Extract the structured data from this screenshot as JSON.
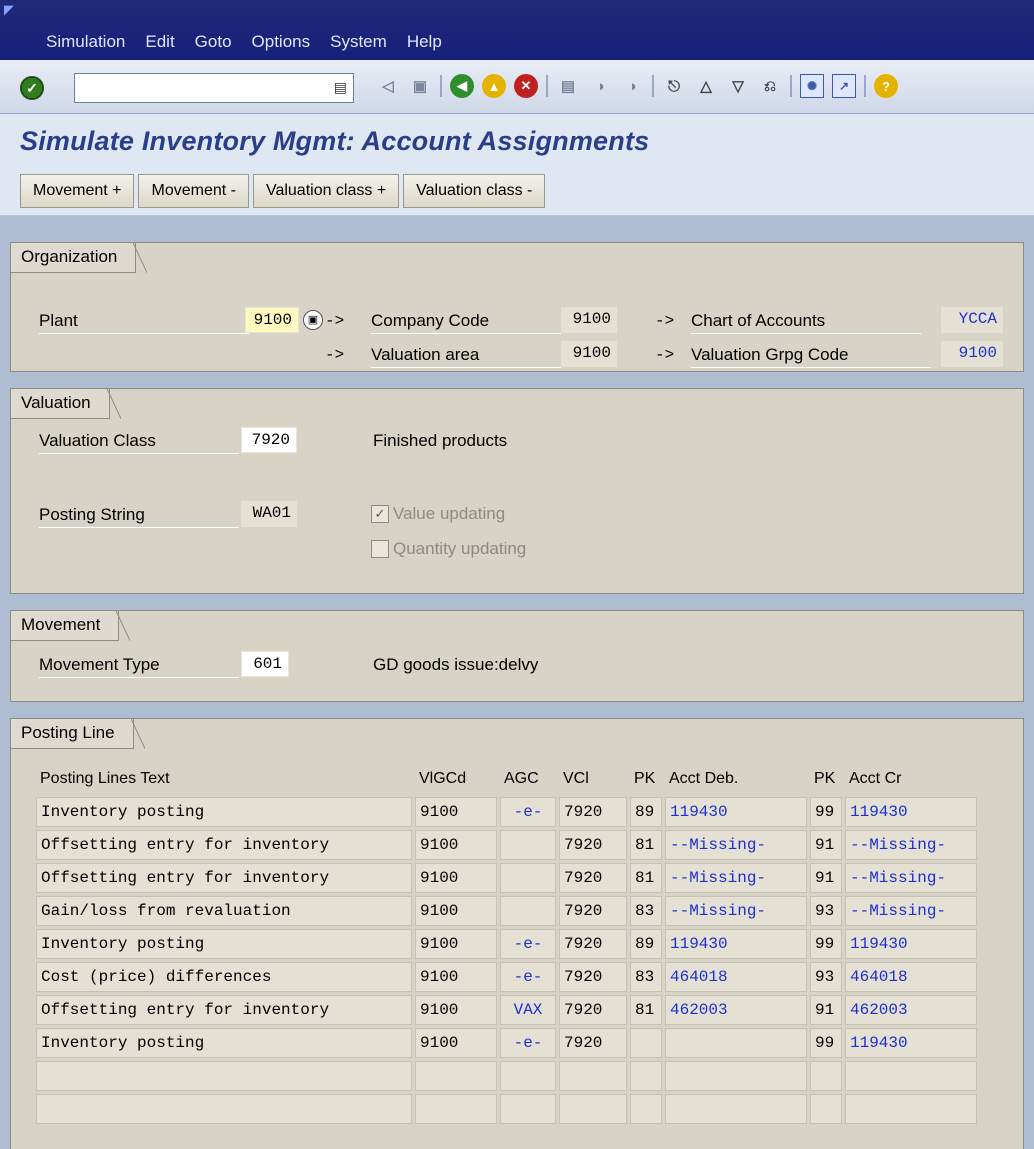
{
  "menu": [
    "Simulation",
    "Edit",
    "Goto",
    "Options",
    "System",
    "Help"
  ],
  "page_title": "Simulate Inventory Mgmt: Account Assignments",
  "app_buttons": [
    "Movement +",
    "Movement -",
    "Valuation class +",
    "Valuation class -"
  ],
  "organization": {
    "title": "Organization",
    "plant_label": "Plant",
    "plant_value": "9100",
    "company_code_label": "Company Code",
    "company_code_value": "9100",
    "chart_label": "Chart of Accounts",
    "chart_value": "YCCA",
    "valuation_area_label": "Valuation area",
    "valuation_area_value": "9100",
    "valuation_grpg_label": "Valuation Grpg Code",
    "valuation_grpg_value": "9100",
    "arrow": "->"
  },
  "valuation": {
    "title": "Valuation",
    "class_label": "Valuation Class",
    "class_value": "7920",
    "class_text": "Finished products",
    "posting_string_label": "Posting String",
    "posting_string_value": "WA01",
    "value_updating": "Value updating",
    "value_updating_checked": true,
    "quantity_updating": "Quantity updating",
    "quantity_updating_checked": false
  },
  "movement": {
    "title": "Movement",
    "type_label": "Movement Type",
    "type_value": "601",
    "type_text": "GD goods issue:delvy"
  },
  "posting_line": {
    "title": "Posting Line",
    "headers": [
      "Posting Lines Text",
      "VlGCd",
      "AGC",
      "VCl",
      "PK",
      "Acct Deb.",
      "PK",
      "Acct Cr"
    ],
    "rows": [
      [
        "Inventory posting",
        "9100",
        "-e-",
        "7920",
        "89",
        "119430",
        "99",
        "119430"
      ],
      [
        "Offsetting entry for inventory",
        "9100",
        "",
        "7920",
        "81",
        "--Missing-",
        "91",
        "--Missing-"
      ],
      [
        "Offsetting entry for inventory",
        "9100",
        "",
        "7920",
        "81",
        "--Missing-",
        "91",
        "--Missing-"
      ],
      [
        "Gain/loss from revaluation",
        "9100",
        "",
        "7920",
        "83",
        "--Missing-",
        "93",
        "--Missing-"
      ],
      [
        "Inventory posting",
        "9100",
        "-e-",
        "7920",
        "89",
        "119430",
        "99",
        "119430"
      ],
      [
        "Cost (price) differences",
        "9100",
        "-e-",
        "7920",
        "83",
        "464018",
        "93",
        "464018"
      ],
      [
        "Offsetting entry for inventory",
        "9100",
        "VAX",
        "7920",
        "81",
        "462003",
        "91",
        "462003"
      ],
      [
        "Inventory posting",
        "9100",
        "-e-",
        "7920",
        "",
        "",
        "99",
        "119430"
      ],
      [
        "",
        "",
        "",
        "",
        "",
        "",
        "",
        ""
      ],
      [
        "",
        "",
        "",
        "",
        "",
        "",
        "",
        ""
      ]
    ]
  }
}
